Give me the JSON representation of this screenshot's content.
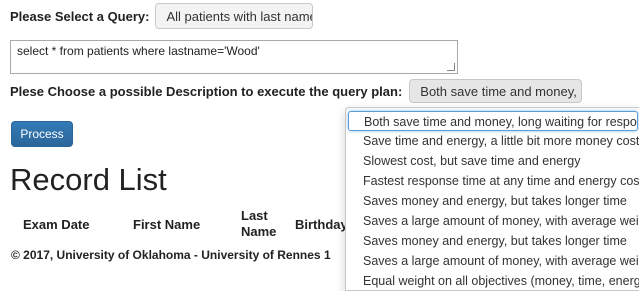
{
  "query_section": {
    "label": "Please Select a Query:",
    "selected": "All patients with last name of"
  },
  "sql_text": "select * from patients where lastname='Wood'",
  "plan_section": {
    "label": "Plese Choose a possible Description to execute the query plan:",
    "selected": "Both save time and money, lo"
  },
  "process_label": "Process",
  "record_title": "Record List",
  "table": {
    "columns": [
      "Exam Date",
      "First Name",
      "Last Name",
      "Birthday"
    ]
  },
  "footer": "© 2017, University of Oklahoma - University of Rennes 1",
  "plan_options": [
    "Both save time and money, long waiting for respons",
    "Save time and energy, a little bit more money cost",
    "Slowest cost, but save time and energy",
    "Fastest response time at any time and energy cost",
    "Saves money and energy, but takes longer time",
    "Saves a large amount of money, with average weight",
    "Saves money and energy, but takes longer time",
    "Saves a large amount of money, with average weight",
    "Equal weight on all objectives (money, time, energ"
  ],
  "colors": {
    "primary_button": "#337ab7",
    "focus_outline": "#5b9dd9"
  },
  "icons": {
    "dropdown_caret": "caret-down-icon"
  }
}
